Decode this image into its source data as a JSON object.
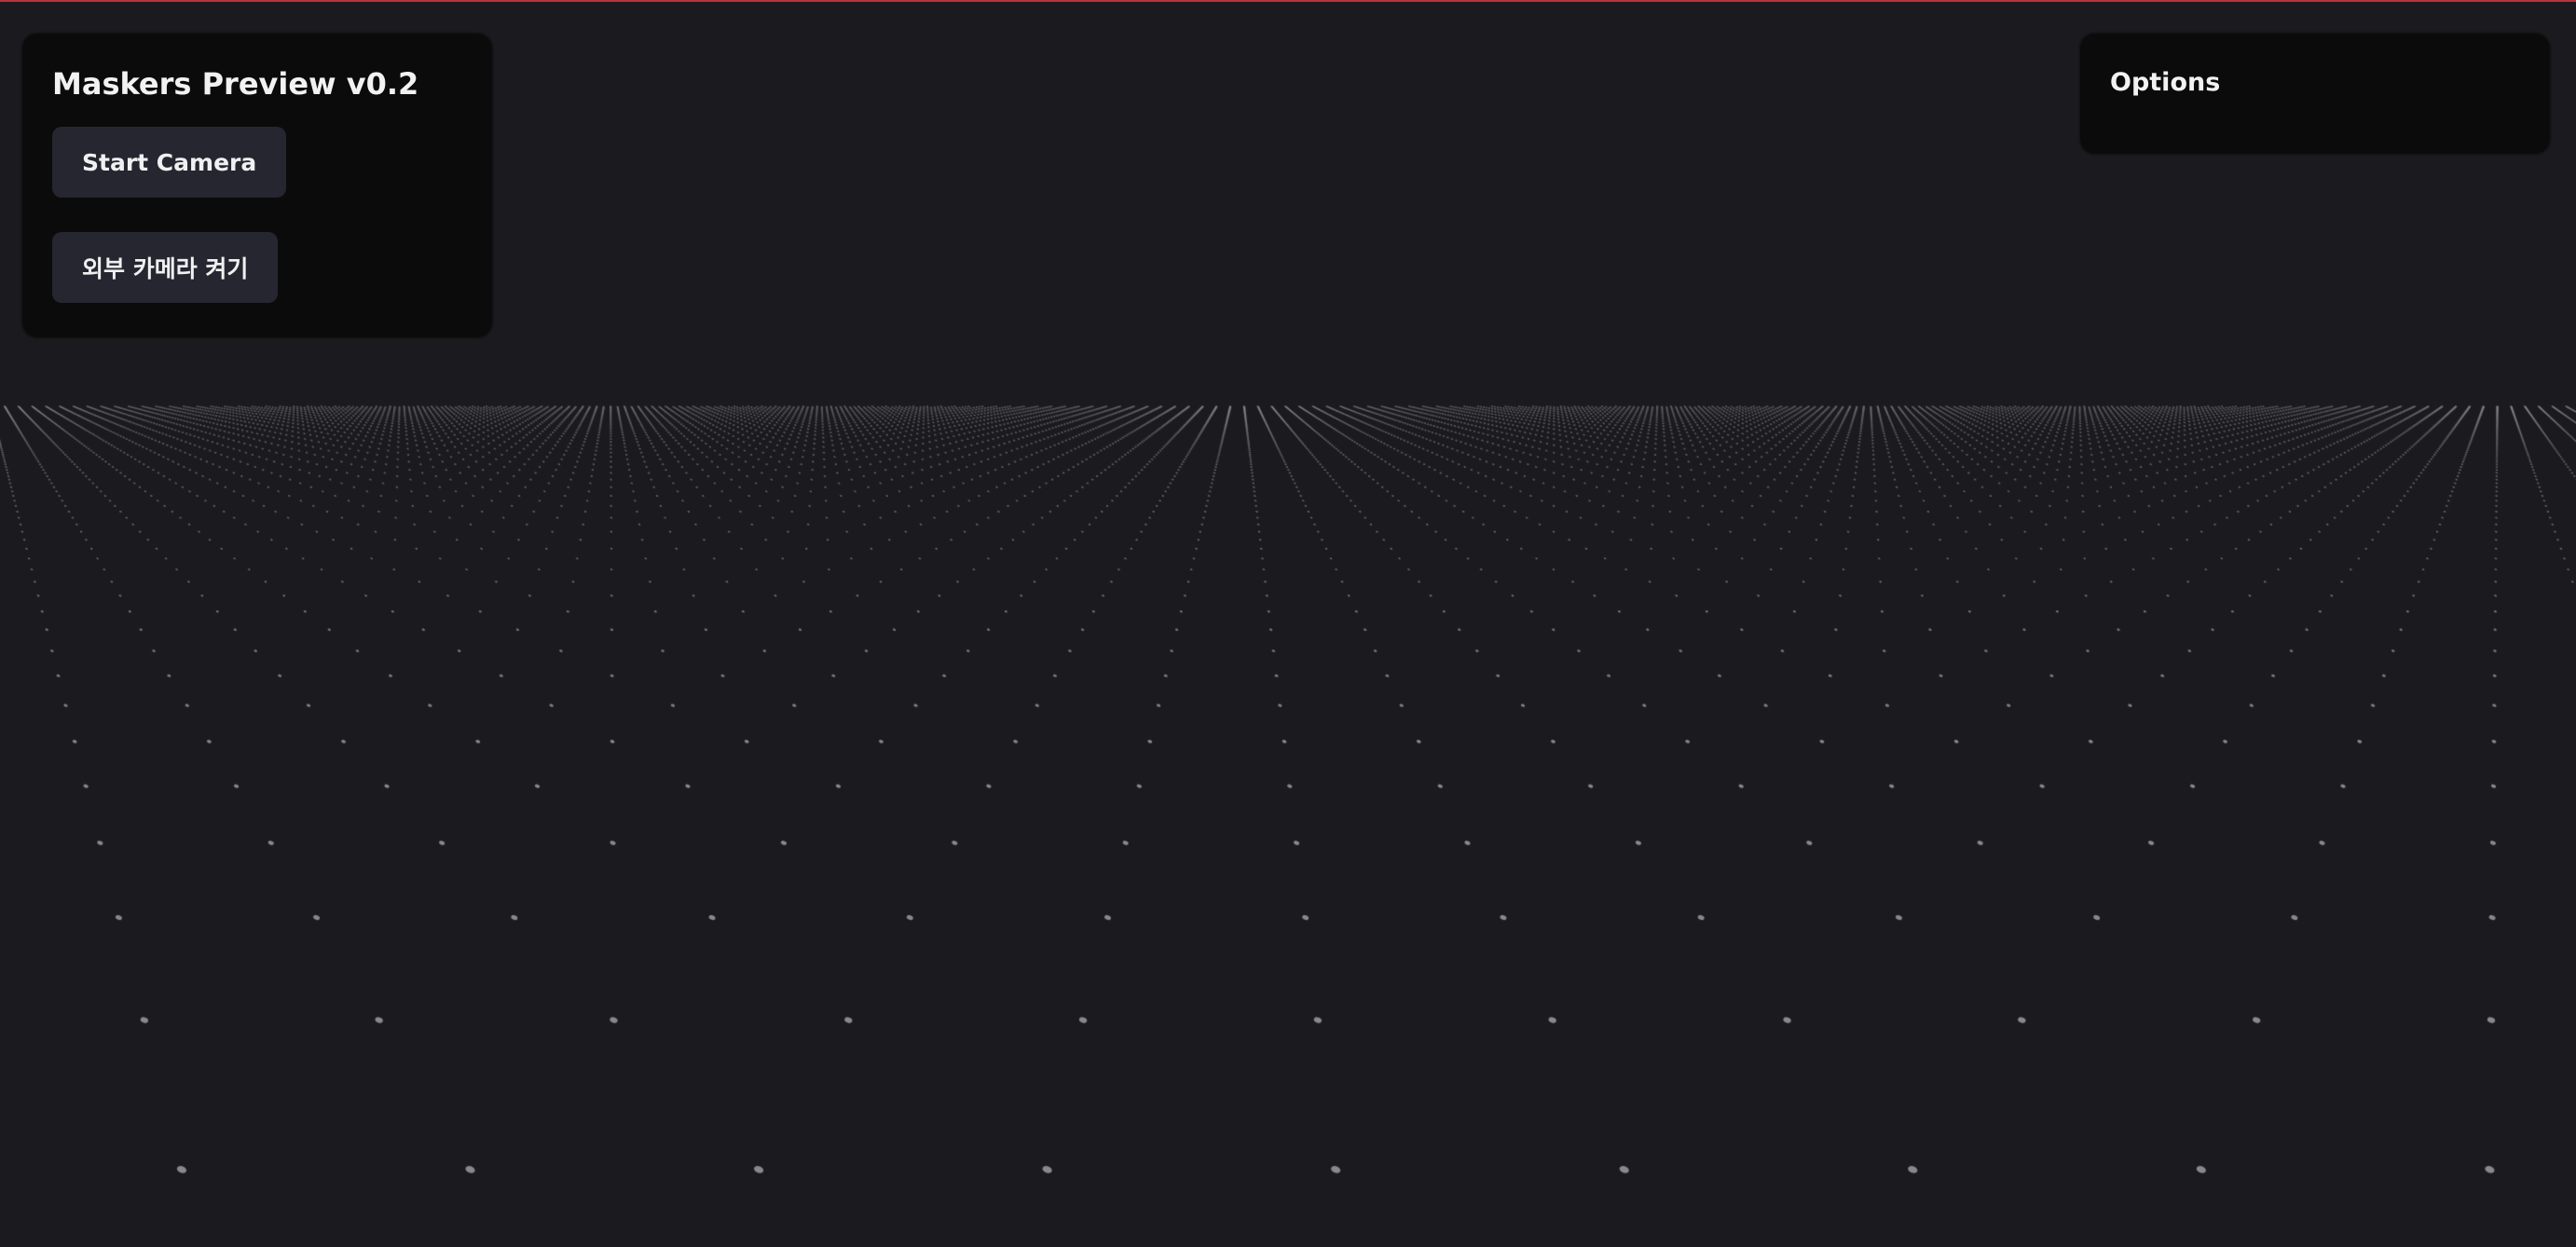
{
  "app": {
    "title": "Maskers Preview v0.2",
    "accent_color": "#b8353f",
    "background_color": "#1b1b1f"
  },
  "controls": {
    "start_camera_label": "Start Camera",
    "external_camera_label": "외부 카메라 켜기"
  },
  "options_panel": {
    "title": "Options"
  },
  "scene": {
    "description_kind": "perspective-dot-grid",
    "dot_color": "#8e8e94"
  }
}
